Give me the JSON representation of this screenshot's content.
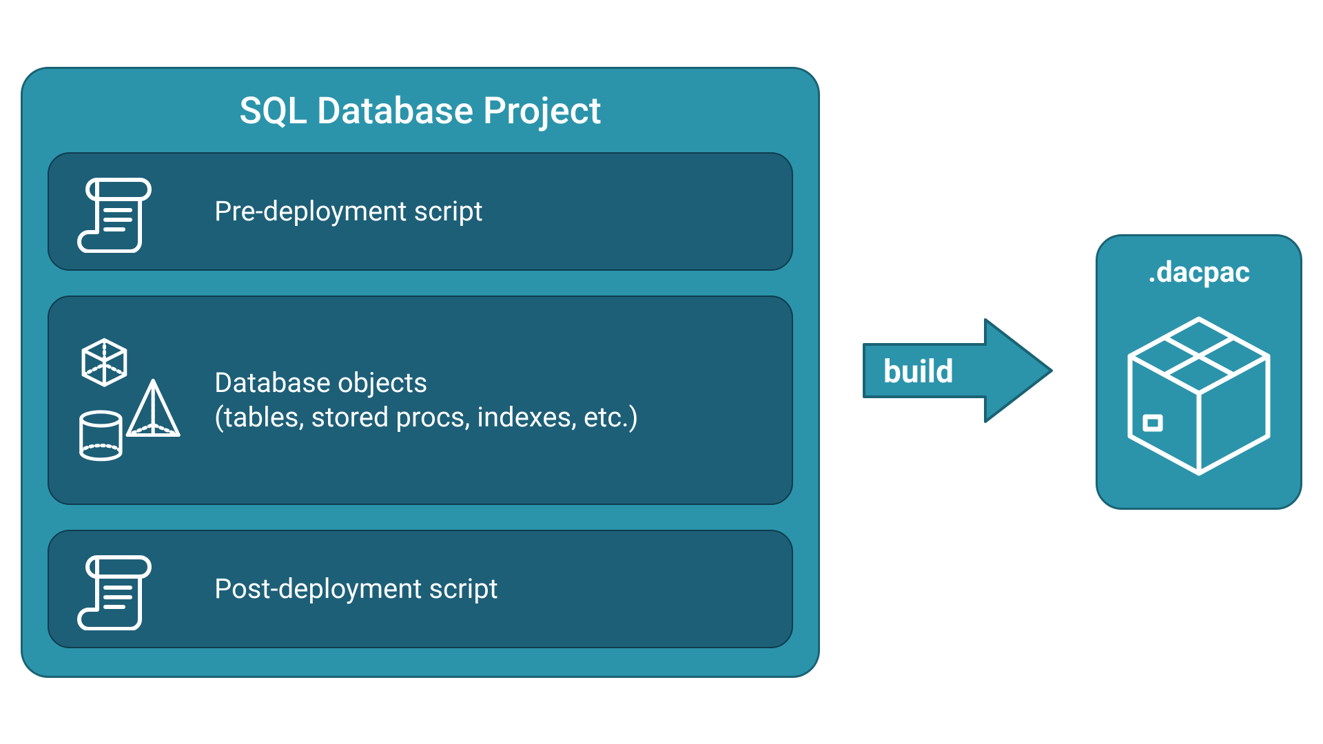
{
  "project": {
    "title": "SQL Database Project",
    "cards": {
      "pre": "Pre-deployment script",
      "objects_line1": "Database objects",
      "objects_line2": "(tables, stored procs, indexes, etc.)",
      "post": "Post-deployment script"
    }
  },
  "arrow": {
    "label": "build"
  },
  "output": {
    "label": ".dacpac"
  },
  "colors": {
    "containerFill": "#2b94ab",
    "containerStroke": "#1a6274",
    "cardFill": "#1d5f77",
    "text": "#ffffff"
  }
}
